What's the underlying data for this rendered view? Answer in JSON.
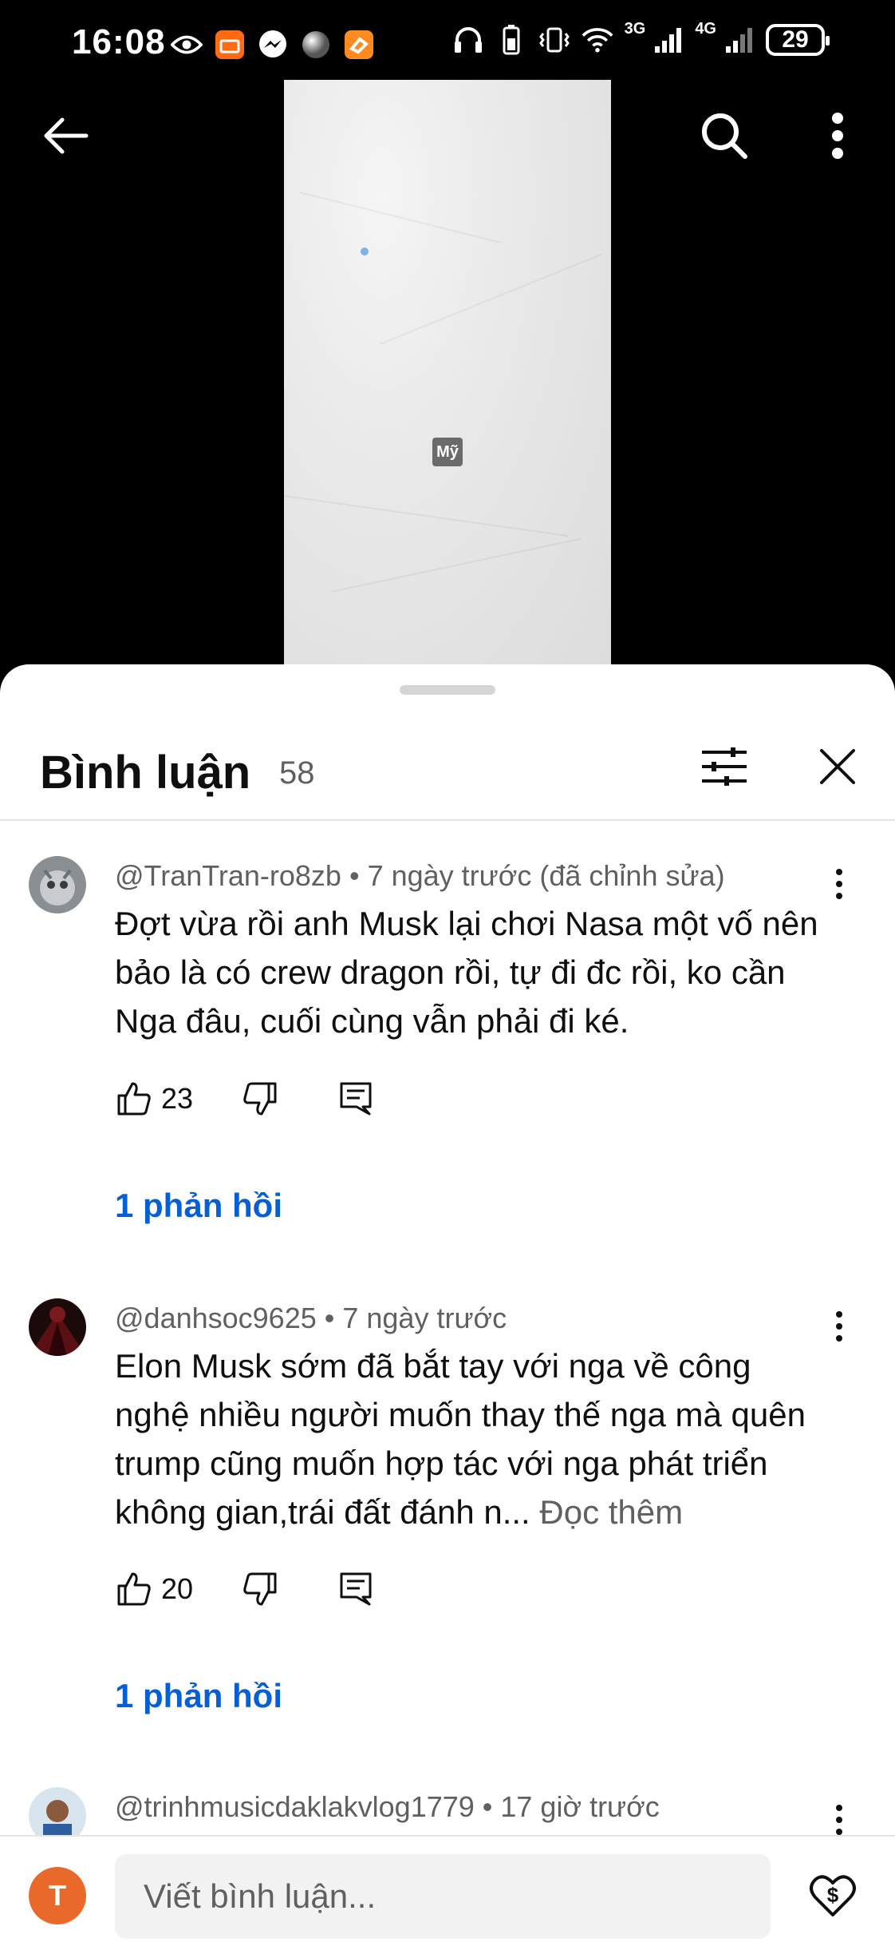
{
  "status_bar": {
    "time": "16:08",
    "net1": "3G",
    "net2": "4G",
    "battery": "29",
    "icons": [
      "eye-icon",
      "store-app-icon",
      "messenger-icon",
      "sphere-app-icon",
      "orange-app-icon",
      "headphones-icon",
      "battery-saver-icon",
      "vibrate-icon",
      "wifi-icon",
      "signal-icon"
    ]
  },
  "video": {
    "tag": "Mỹ"
  },
  "header": {
    "title": "Bình luận",
    "count": "58"
  },
  "comments": [
    {
      "author": "@TranTran-ro8zb",
      "time": "7 ngày trước (đã chỉnh sửa)",
      "text": "Đợt vừa rồi anh Musk lại chơi Nasa một vố nên bảo là có crew dragon rồi, tự đi đc rồi, ko cần Nga đâu, cuối cùng vẫn phải đi ké.",
      "likes": "23",
      "replies": "1 phản hồi"
    },
    {
      "author": "@danhsoc9625",
      "time": "7 ngày trước",
      "text": "Elon Musk sớm đã bắt tay với nga về công nghệ nhiều người muốn thay thế nga mà quên trump cũng muốn hợp tác với nga phát triển không gian,trái đất đánh n...",
      "read_more": "Đọc thêm",
      "likes": "20",
      "replies": "1 phản hồi"
    },
    {
      "author": "@trinhmusicdaklakvlog1779",
      "time": "17 giờ trước"
    }
  ],
  "composer": {
    "avatar_letter": "T",
    "placeholder": "Viết bình luận..."
  },
  "colors": {
    "link_blue": "#065fd4",
    "avatar_orange": "#e8692a",
    "meta_gray": "#606060"
  }
}
